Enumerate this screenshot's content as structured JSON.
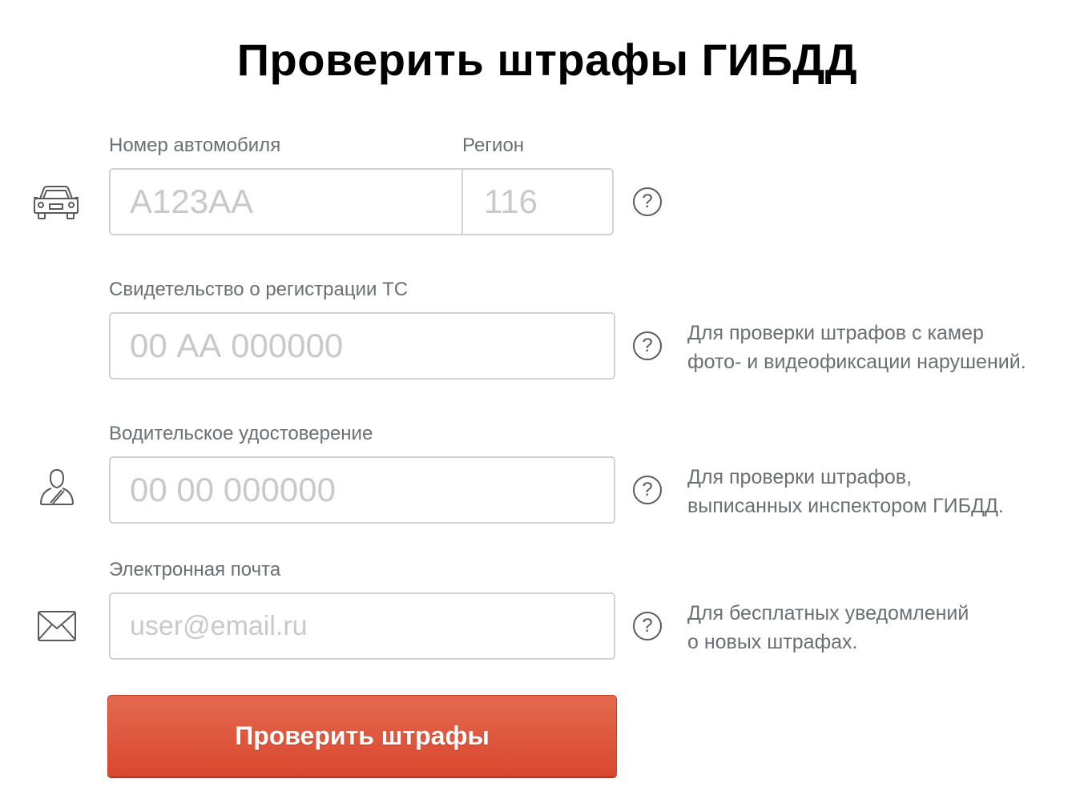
{
  "page": {
    "title": "Проверить штрафы ГИБДД"
  },
  "form": {
    "plate": {
      "label": "Номер автомобиля",
      "placeholder": "А123АА",
      "icon": "car-icon"
    },
    "region": {
      "label": "Регион",
      "placeholder": "116"
    },
    "sts": {
      "label": "Свидетельство о регистрации ТС",
      "placeholder": "00 АА 000000",
      "hint_line1": "Для проверки штрафов с камер",
      "hint_line2": "фото- и видеофиксации нарушений."
    },
    "license": {
      "label": "Водительское удостоверение",
      "placeholder": "00 00 000000",
      "icon": "driver-icon",
      "hint_line1": "Для проверки штрафов,",
      "hint_line2": "выписанных инспектором ГИБДД."
    },
    "email": {
      "label": "Электронная почта",
      "placeholder": "user@email.ru",
      "icon": "envelope-icon",
      "hint_line1": "Для бесплатных уведомлений",
      "hint_line2": "о новых штрафах."
    },
    "help_glyph": "?",
    "submit_label": "Проверить штрафы"
  },
  "colors": {
    "accent": "#dd5538",
    "label": "#6a6f73",
    "placeholder": "#c9c9c9",
    "border": "#d2d2d2"
  }
}
